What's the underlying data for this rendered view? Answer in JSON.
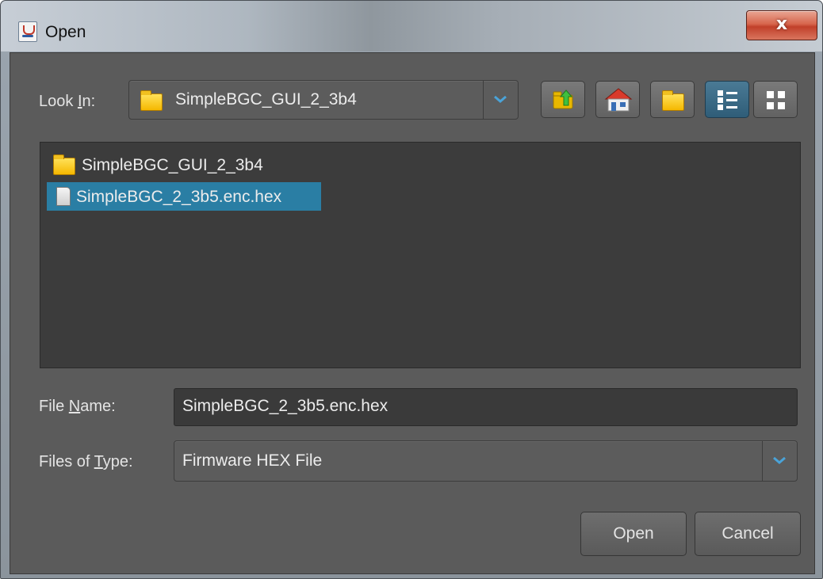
{
  "window": {
    "title": "Open",
    "close_glyph": "x"
  },
  "look_in": {
    "label_pre": "Look ",
    "label_mnemonic": "I",
    "label_post": "n:",
    "value": "SimpleBGC_GUI_2_3b4"
  },
  "toolbar": {
    "icons": [
      "up-one-level-icon",
      "home-icon",
      "new-folder-icon",
      "list-view-icon",
      "details-view-icon"
    ],
    "active_view": "list-view"
  },
  "files": [
    {
      "name": "SimpleBGC_GUI_2_3b4",
      "type": "folder",
      "selected": false
    },
    {
      "name": "SimpleBGC_2_3b5.enc.hex",
      "type": "file",
      "selected": true
    }
  ],
  "file_name": {
    "label_pre": "File ",
    "label_mnemonic": "N",
    "label_post": "ame:",
    "value": "SimpleBGC_2_3b5.enc.hex"
  },
  "file_type": {
    "label_pre": "Files of ",
    "label_mnemonic": "T",
    "label_post": "ype:",
    "value": "Firmware HEX File"
  },
  "buttons": {
    "open": "Open",
    "cancel": "Cancel"
  },
  "colors": {
    "selection": "#2a7ea4",
    "panel": "#5b5b5b",
    "list_bg": "#3c3c3c",
    "accent_arrow": "#4aa3d8"
  }
}
